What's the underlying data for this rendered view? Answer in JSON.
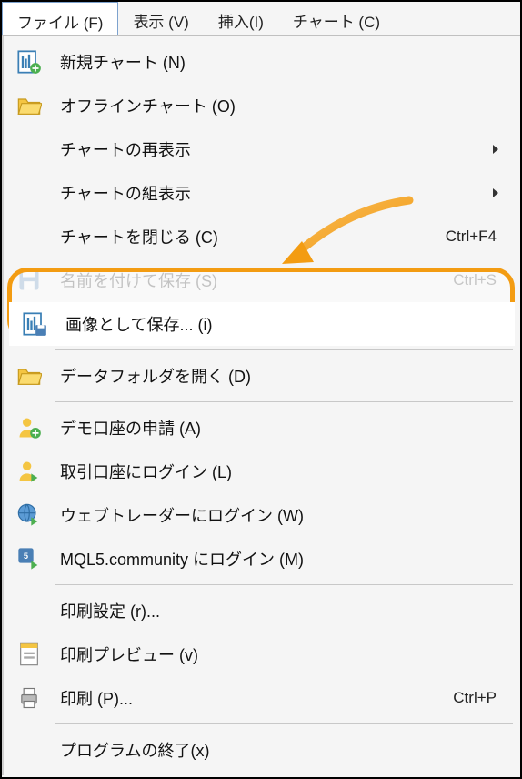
{
  "menubar": {
    "file": "ファイル (F)",
    "view": "表示 (V)",
    "insert": "挿入(I)",
    "chart": "チャート (C)"
  },
  "menu": {
    "new_chart": "新規チャート (N)",
    "offline_chart": "オフラインチャート (O)",
    "redisplay_chart": "チャートの再表示",
    "chart_group": "チャートの組表示",
    "close_chart": "チャートを閉じる (C)",
    "close_chart_shortcut": "Ctrl+F4",
    "save_as_name": "名前を付けて保存 (S)",
    "save_as_name_shortcut": "Ctrl+S",
    "save_as_image": "画像として保存... (i)",
    "open_data_folder": "データフォルダを開く (D)",
    "demo_account": "デモ口座の申請 (A)",
    "login_trade": "取引口座にログイン (L)",
    "login_web": "ウェブトレーダーにログイン (W)",
    "login_mql5": "MQL5.community にログイン (M)",
    "print_setup": "印刷設定 (r)...",
    "print_preview": "印刷プレビュー (v)",
    "print": "印刷 (P)...",
    "print_shortcut": "Ctrl+P",
    "exit": "プログラムの終了(x)"
  },
  "colors": {
    "highlight": "#f39c12"
  }
}
